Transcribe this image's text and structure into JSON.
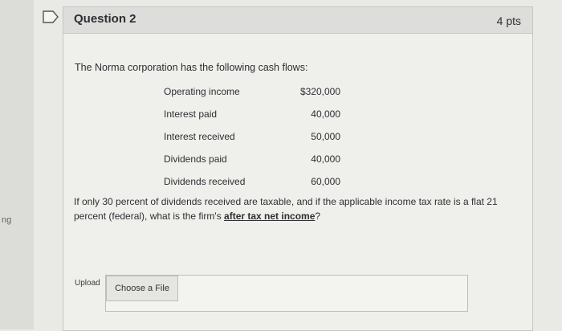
{
  "question": {
    "title": "Question 2",
    "points": "4 pts"
  },
  "body": {
    "intro": "The Norma corporation has the following cash flows:",
    "rows": [
      {
        "label": "Operating income",
        "value": "$320,000"
      },
      {
        "label": "Interest paid",
        "value": "40,000"
      },
      {
        "label": "Interest received",
        "value": "50,000"
      },
      {
        "label": "Dividends paid",
        "value": "40,000"
      },
      {
        "label": "Dividends received",
        "value": "60,000"
      }
    ],
    "question_part1": "If only 30 percent of dividends received are taxable, and if the applicable income tax rate is a flat 21 percent (federal), what is the firm's ",
    "question_underlined": "after tax net income",
    "question_part2": "?"
  },
  "upload": {
    "label": "Upload",
    "button": "Choose a File"
  },
  "edge": {
    "stub_text": "ng"
  },
  "colors": {
    "page_bg": "#e9e9e6",
    "header_bg": "#dddddb",
    "border": "#c6c6c2"
  }
}
